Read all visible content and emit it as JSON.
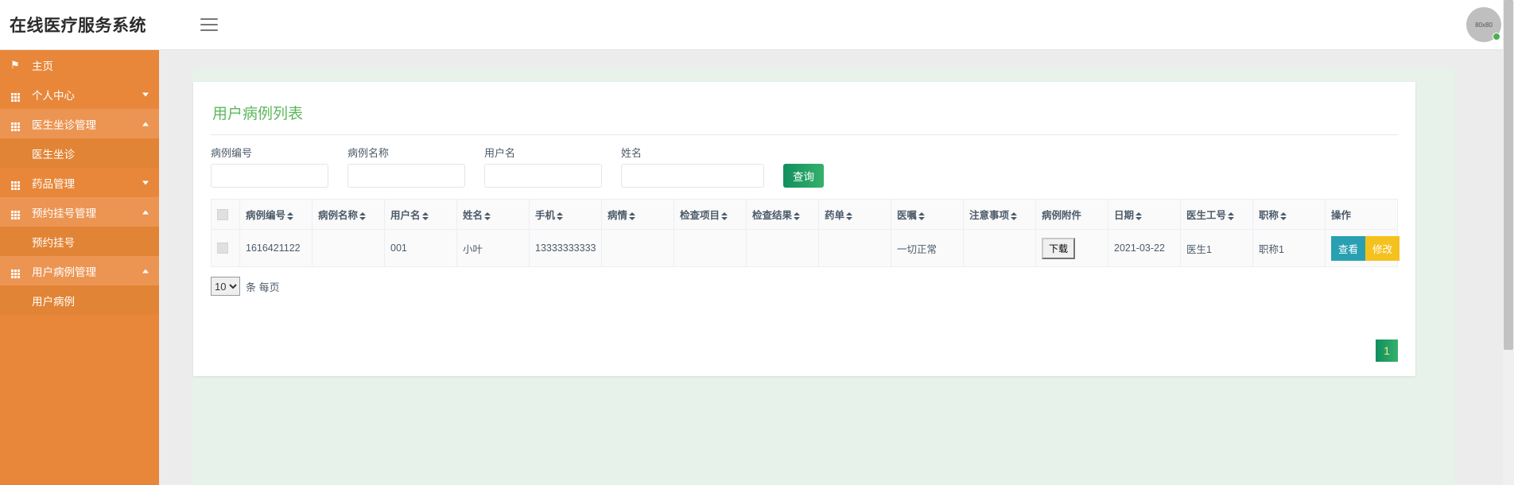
{
  "header": {
    "title": "在线医疗服务系统",
    "menu_icon": "hamburger-icon",
    "avatar_label": "80x80"
  },
  "sidebar": {
    "items": [
      {
        "label": "主页",
        "icon": "flag-icon",
        "type": "link",
        "expanded": false
      },
      {
        "label": "个人中心",
        "icon": "grid-icon",
        "type": "parent",
        "expanded": false,
        "caret": "down"
      },
      {
        "label": "医生坐诊管理",
        "icon": "grid-icon",
        "type": "parent",
        "expanded": true,
        "caret": "up"
      },
      {
        "label": "医生坐诊",
        "type": "sub"
      },
      {
        "label": "药品管理",
        "icon": "grid-icon",
        "type": "parent",
        "expanded": false,
        "caret": "down"
      },
      {
        "label": "预约挂号管理",
        "icon": "grid-icon",
        "type": "parent",
        "expanded": true,
        "caret": "up"
      },
      {
        "label": "预约挂号",
        "type": "sub"
      },
      {
        "label": "用户病例管理",
        "icon": "grid-icon",
        "type": "parent",
        "expanded": true,
        "caret": "up"
      },
      {
        "label": "用户病例",
        "type": "sub"
      }
    ]
  },
  "main": {
    "card_title": "用户病例列表",
    "search": {
      "fields": [
        {
          "label": "病例编号",
          "value": "",
          "placeholder": ""
        },
        {
          "label": "病例名称",
          "value": "",
          "placeholder": ""
        },
        {
          "label": "用户名",
          "value": "",
          "placeholder": ""
        },
        {
          "label": "姓名",
          "value": "",
          "placeholder": ""
        }
      ],
      "query_button": "查询"
    },
    "table": {
      "columns": [
        {
          "label": "",
          "sortable": false,
          "checkbox": true
        },
        {
          "label": "病例编号",
          "sortable": true
        },
        {
          "label": "病例名称",
          "sortable": true
        },
        {
          "label": "用户名",
          "sortable": true
        },
        {
          "label": "姓名",
          "sortable": true
        },
        {
          "label": "手机",
          "sortable": true
        },
        {
          "label": "病情",
          "sortable": true
        },
        {
          "label": "检查项目",
          "sortable": true
        },
        {
          "label": "检查结果",
          "sortable": true
        },
        {
          "label": "药单",
          "sortable": true
        },
        {
          "label": "医嘱",
          "sortable": true
        },
        {
          "label": "注意事项",
          "sortable": true
        },
        {
          "label": "病例附件",
          "sortable": false
        },
        {
          "label": "日期",
          "sortable": true
        },
        {
          "label": "医生工号",
          "sortable": true
        },
        {
          "label": "职称",
          "sortable": true
        },
        {
          "label": "操作",
          "sortable": false
        }
      ],
      "rows": [
        {
          "case_no": "1616421122",
          "case_name": "",
          "username": "001",
          "name": "小叶",
          "phone": "13333333333",
          "condition": "",
          "exam_item": "",
          "exam_result": "",
          "prescription": "",
          "advice": "一切正常",
          "notes": "",
          "attachment_button": "下载",
          "date": "2021-03-22",
          "doctor_id": "医生1",
          "title": "职称1",
          "actions": {
            "view": "查看",
            "edit": "修改"
          }
        }
      ]
    },
    "footer": {
      "page_size": "10",
      "page_size_options": [
        "10"
      ],
      "per_page_text": "条 每页",
      "current_page": "1"
    }
  },
  "colors": {
    "sidebar": "#e8873a",
    "sidebar_expanded": "#ec9553",
    "sidebar_sub": "#e28435",
    "title_green": "#5cb85c",
    "button_green": "#0f8f5f",
    "view_teal": "#29a0b1",
    "edit_yellow": "#f5c11e",
    "status_online": "#4caf50"
  }
}
